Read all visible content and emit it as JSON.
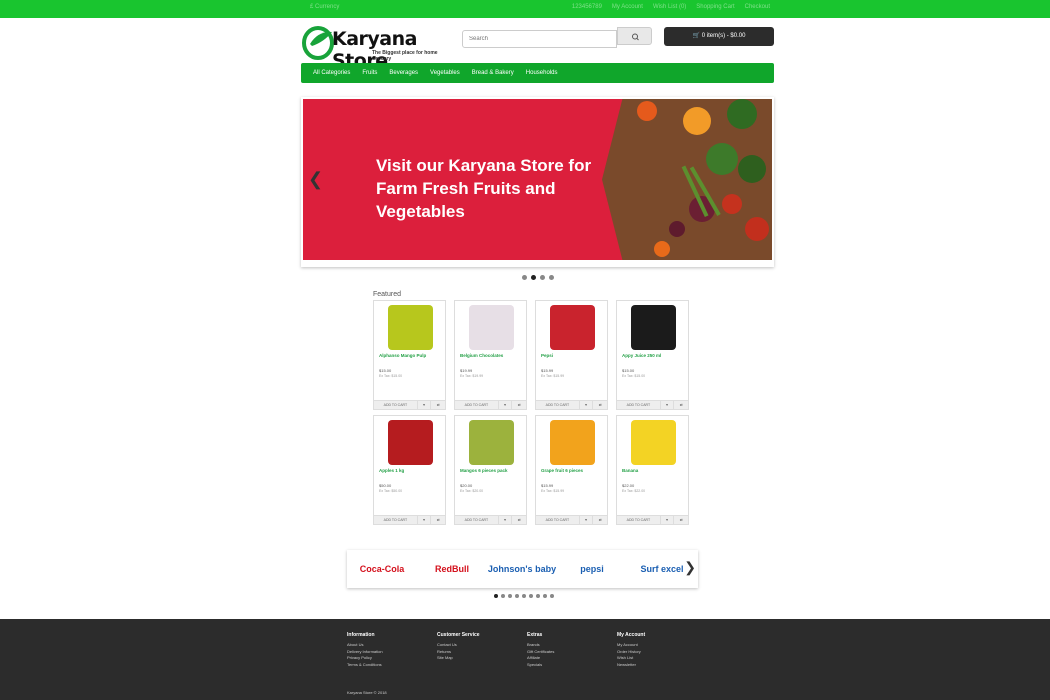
{
  "topbar": {
    "currency": "£ Currency",
    "links": [
      "123456789",
      "My Account",
      "Wish List (0)",
      "Shopping Cart",
      "Checkout"
    ]
  },
  "header": {
    "brand": "Karyana Store",
    "tagline": "The Biggest place for home Grocery",
    "search_placeholder": "Search",
    "cart": "0 item(s) - $0.00"
  },
  "nav": [
    "All Categories",
    "Fruits",
    "Beverages",
    "Vegetables",
    "Bread & Bakery",
    "Households"
  ],
  "banner": {
    "text": "Visit our Karyana Store for Farm Fresh  Fruits and Vegetables"
  },
  "featured": {
    "title": "Featured",
    "products": [
      {
        "name": "Alphanso Mango Pulp",
        "price": "$15.00",
        "tax": "Ex Tax: $15.00",
        "color": "#b7c71d"
      },
      {
        "name": "Belgium Chocolates",
        "price": "$19.99",
        "tax": "Ex Tax: $19.99",
        "color": "#e7dfe6"
      },
      {
        "name": "Pepsi",
        "price": "$15.99",
        "tax": "Ex Tax: $15.99",
        "color": "#c9232d"
      },
      {
        "name": "Appy Juice 250 ml",
        "price": "$15.00",
        "tax": "Ex Tax: $15.00",
        "color": "#1b1b1b"
      },
      {
        "name": "Apples 1 kg",
        "price": "$50.00",
        "tax": "Ex Tax: $50.00",
        "color": "#b51c1f"
      },
      {
        "name": "Mangos 6 pieces pack",
        "price": "$20.00",
        "tax": "Ex Tax: $20.00",
        "color": "#9cb23d"
      },
      {
        "name": "Grape fruit 6 pieces",
        "price": "$15.99",
        "tax": "Ex Tax: $15.99",
        "color": "#f2a31c"
      },
      {
        "name": "Banana",
        "price": "$22.00",
        "tax": "Ex Tax: $22.00",
        "color": "#f3d324"
      }
    ],
    "actions": [
      "ADD TO CART",
      "♥",
      "⇄"
    ]
  },
  "brands": [
    {
      "name": "Coca-Cola",
      "color": "#d4101c"
    },
    {
      "name": "RedBull",
      "color": "#d4101c"
    },
    {
      "name": "Johnson's baby",
      "color": "#1b5fb2"
    },
    {
      "name": "pepsi",
      "color": "#1b5fb2"
    },
    {
      "name": "Surf excel",
      "color": "#1b5fb2"
    }
  ],
  "footer": {
    "columns": [
      {
        "title": "Information",
        "links": [
          "About Us",
          "Delivery Information",
          "Privacy Policy",
          "Terms & Conditions"
        ]
      },
      {
        "title": "Customer Service",
        "links": [
          "Contact Us",
          "Returns",
          "Site Map"
        ]
      },
      {
        "title": "Extras",
        "links": [
          "Brands",
          "Gift Certificates",
          "Affiliate",
          "Specials"
        ]
      },
      {
        "title": "My Account",
        "links": [
          "My Account",
          "Order History",
          "Wish List",
          "Newsletter"
        ]
      }
    ],
    "copyright": "Karyana Store © 2018"
  }
}
